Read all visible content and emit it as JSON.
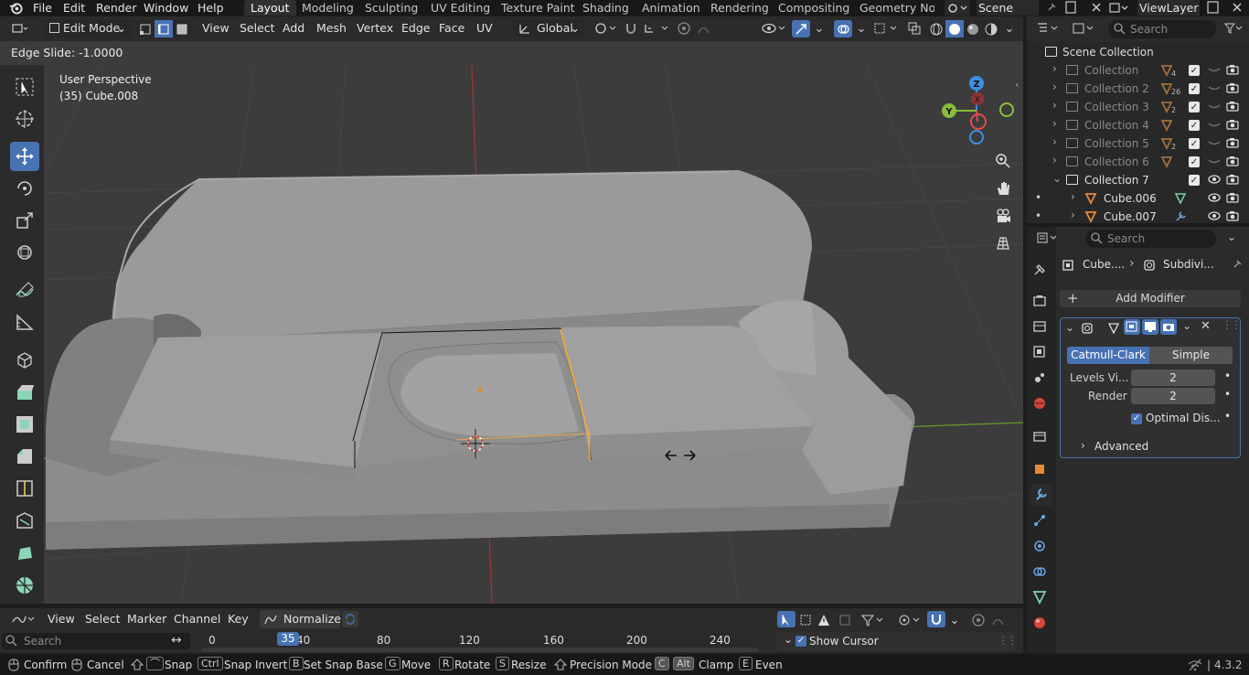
{
  "topbar": {
    "menus": [
      "File",
      "Edit",
      "Render",
      "Window",
      "Help"
    ],
    "workspaces": [
      "Layout",
      "Modeling",
      "Sculpting",
      "UV Editing",
      "Texture Paint",
      "Shading",
      "Animation",
      "Rendering",
      "Compositing",
      "Geometry Node"
    ],
    "scene": "Scene",
    "view_layer": "ViewLayer"
  },
  "viewport_header": {
    "mode": "Edit Mode",
    "menus": [
      "View",
      "Select",
      "Add",
      "Mesh",
      "Vertex",
      "Edge",
      "Face",
      "UV"
    ],
    "transform_orientation": "Global"
  },
  "operator_status": "Edge Slide: -1.0000",
  "viewport": {
    "perspective_label": "User Perspective",
    "object_label": "(35) Cube.008",
    "gizmo_axes": {
      "z": "Z",
      "y": "Y",
      "x": "X"
    }
  },
  "outliner": {
    "search_placeholder": "Search",
    "root": "Scene Collection",
    "rows": [
      {
        "label": "Collection",
        "count": "4"
      },
      {
        "label": "Collection 2",
        "count": "26"
      },
      {
        "label": "Collection 3",
        "count": "2"
      },
      {
        "label": "Collection 4",
        "count": ""
      },
      {
        "label": "Collection 5",
        "count": "2"
      },
      {
        "label": "Collection 6",
        "count": ""
      },
      {
        "label": "Collection 7",
        "count": ""
      },
      {
        "label": "Cube.006",
        "count": ""
      },
      {
        "label": "Cube.007",
        "count": ""
      }
    ]
  },
  "properties": {
    "search_placeholder": "Search",
    "breadcrumb_object": "Cube....",
    "breadcrumb_modifier": "Subdivi...",
    "add_modifier": "Add Modifier",
    "subdiv_type_catmull": "Catmull-Clark",
    "subdiv_type_simple": "Simple",
    "levels_viewport_label": "Levels Vi...",
    "levels_viewport_value": "2",
    "render_label": "Render",
    "render_value": "2",
    "optimal_display": "Optimal Dis...",
    "advanced": "Advanced"
  },
  "timeline": {
    "menus": [
      "View",
      "Select",
      "Marker",
      "Channel",
      "Key"
    ],
    "normalize": "Normalize",
    "search_placeholder": "Search",
    "current_frame": "35",
    "ticks": [
      "0",
      "40",
      "80",
      "120",
      "160",
      "200",
      "240"
    ],
    "show_cursor": "Show Cursor"
  },
  "statusbar": {
    "confirm": "Confirm",
    "cancel": "Cancel",
    "snap": "Snap",
    "snap_invert_key": "Ctrl",
    "snap_invert": "Snap Invert",
    "set_snap_base_key": "B",
    "set_snap_base": "Set Snap Base",
    "move_key": "G",
    "move": "Move",
    "rotate_key": "R",
    "rotate": "Rotate",
    "resize_key": "S",
    "resize": "Resize",
    "precision": "Precision Mode",
    "clamp_key1": "C",
    "clamp_key2": "Alt",
    "clamp": "Clamp",
    "even_key": "E",
    "even": "Even",
    "version": "4.3.2"
  },
  "colors": {
    "accent": "#4772b3",
    "edge_highlight": "#ffaa33",
    "gizmo_x": "#e34a4a",
    "gizmo_y": "#8bbd3b",
    "gizmo_z": "#3d8ee6"
  }
}
